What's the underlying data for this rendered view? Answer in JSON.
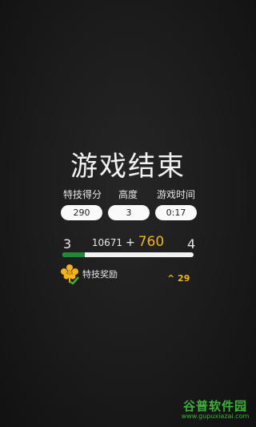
{
  "result": {
    "title": "游戏结束",
    "stats": [
      {
        "label": "特技得分",
        "value": "290"
      },
      {
        "label": "高度",
        "value": "3"
      },
      {
        "label": "游戏时间",
        "value": "0:17"
      }
    ],
    "level": {
      "current": "3",
      "next": "4",
      "score_base": "10671",
      "score_plus": "+",
      "score_gain": "760",
      "progress_fraction": 0.17
    },
    "bonus": {
      "label": "特技奖励",
      "value": "^ 29",
      "icon": "flower-check-icon"
    }
  },
  "watermark": {
    "text": "谷普软件园",
    "url": "www.gupuxiazai.com"
  },
  "colors": {
    "accent_gold": "#f1b41c",
    "progress_green": "#1f8a33",
    "watermark_green": "#3fae3a"
  }
}
